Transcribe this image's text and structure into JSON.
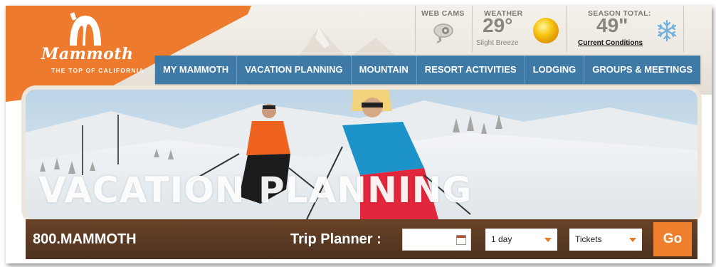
{
  "brand": {
    "name": "Mammoth",
    "tagline": "THE TOP OF CALIFORNIA",
    "color": "#ee7a2d"
  },
  "webcams": {
    "label": "WEB CAMS",
    "icon": "webcam-icon"
  },
  "weather": {
    "label": "WEATHER",
    "temperature": "29°",
    "condition": "Slight Breeze",
    "icon": "sun-icon"
  },
  "season": {
    "label": "SEASON TOTAL:",
    "snowfall": "49\"",
    "link": "Current Conditions",
    "icon": "snowflake-icon"
  },
  "nav": {
    "color": "#3f79a6",
    "items": [
      {
        "label": "MY MAMMOTH"
      },
      {
        "label": "VACATION PLANNING"
      },
      {
        "label": "MOUNTAIN"
      },
      {
        "label": "RESORT ACTIVITIES"
      },
      {
        "label": "LODGING"
      },
      {
        "label": "GROUPS & MEETINGS"
      }
    ]
  },
  "hero": {
    "title": "VACATION PLANNING"
  },
  "booking": {
    "phone": "800.MAMMOTH",
    "trip_planner_label": "Trip Planner :",
    "date_value": "",
    "duration_value": "1 day",
    "product_value": "Tickets",
    "go_label": "Go",
    "go_color": "#f07f2e"
  }
}
